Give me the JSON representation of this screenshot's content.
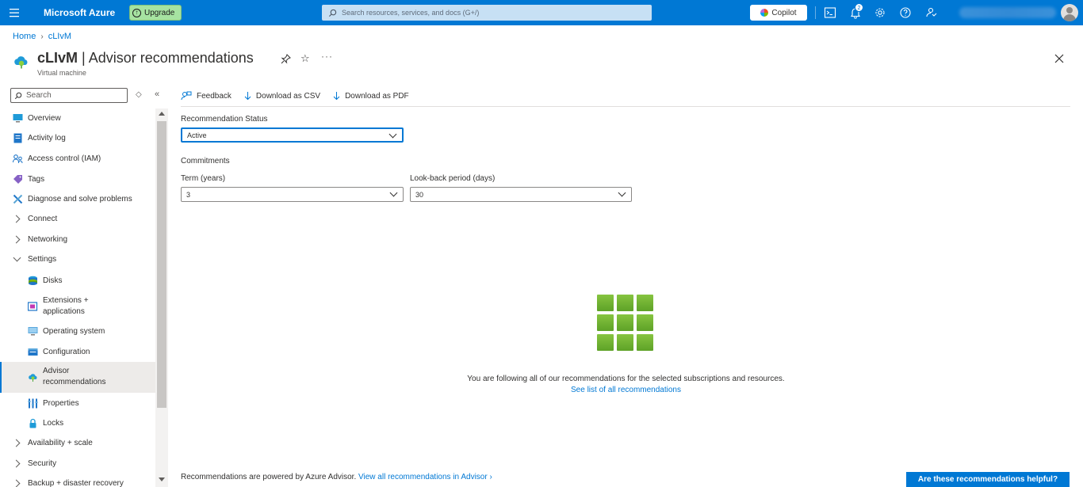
{
  "topbar": {
    "brand": "Microsoft Azure",
    "upgrade_label": "Upgrade",
    "search_placeholder": "Search resources, services, and docs (G+/)",
    "copilot_label": "Copilot",
    "notification_count": "2",
    "accent_color": "#0078d4"
  },
  "breadcrumb": {
    "home": "Home",
    "resource": "cLIvM"
  },
  "header": {
    "resource_name": "cLIvM",
    "separator": " | ",
    "page_name": "Advisor recommendations",
    "subtitle": "Virtual machine",
    "more": "···"
  },
  "sidebar": {
    "search_placeholder": "Search",
    "items": [
      {
        "label": "Overview",
        "icon": "monitor-icon"
      },
      {
        "label": "Activity log",
        "icon": "activity-log-icon"
      },
      {
        "label": "Access control (IAM)",
        "icon": "people-icon"
      },
      {
        "label": "Tags",
        "icon": "tag-icon"
      },
      {
        "label": "Diagnose and solve problems",
        "icon": "wrench-icon"
      },
      {
        "label": "Connect",
        "icon": "chevron-right-icon"
      },
      {
        "label": "Networking",
        "icon": "chevron-right-icon"
      },
      {
        "label": "Settings",
        "icon": "chevron-down-icon"
      },
      {
        "label": "Disks",
        "icon": "disk-icon"
      },
      {
        "label": "Extensions + applications",
        "icon": "extensions-icon"
      },
      {
        "label": "Operating system",
        "icon": "os-icon"
      },
      {
        "label": "Configuration",
        "icon": "configuration-icon"
      },
      {
        "label": "Advisor recommendations",
        "icon": "advisor-icon"
      },
      {
        "label": "Properties",
        "icon": "properties-icon"
      },
      {
        "label": "Locks",
        "icon": "lock-icon"
      },
      {
        "label": "Availability + scale",
        "icon": "chevron-right-icon"
      },
      {
        "label": "Security",
        "icon": "chevron-right-icon"
      },
      {
        "label": "Backup + disaster recovery",
        "icon": "chevron-right-icon"
      }
    ]
  },
  "commands": {
    "feedback": "Feedback",
    "download_csv": "Download as CSV",
    "download_pdf": "Download as PDF"
  },
  "filters": {
    "status_label": "Recommendation Status",
    "status_value": "Active",
    "commitments_label": "Commitments",
    "term_label": "Term (years)",
    "term_value": "3",
    "lookback_label": "Look-back period (days)",
    "lookback_value": "30"
  },
  "empty_state": {
    "message": "You are following all of our recommendations for the selected subscriptions and resources.",
    "link": "See list of all recommendations",
    "icon_color": "#6fb52c"
  },
  "footer": {
    "note": "Recommendations are powered by Azure Advisor.",
    "link": "View all recommendations in Advisor",
    "helpful_button": "Are these recommendations helpful?"
  }
}
